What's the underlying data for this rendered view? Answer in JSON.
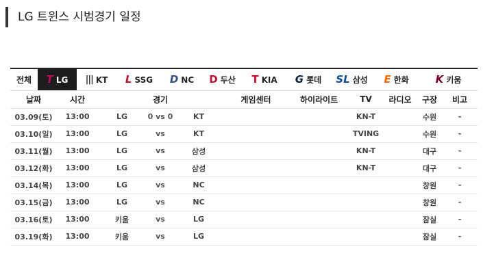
{
  "page": {
    "title": "LG 트윈스 시범경기 일정"
  },
  "tabs": [
    {
      "key": "all",
      "label": "전체",
      "logo": "",
      "active": false
    },
    {
      "key": "lg",
      "label": "LG",
      "logo": "T",
      "active": true
    },
    {
      "key": "kt",
      "label": "KT",
      "logo": "|||",
      "active": false
    },
    {
      "key": "ssg",
      "label": "SSG",
      "logo": "L",
      "active": false
    },
    {
      "key": "nc",
      "label": "NC",
      "logo": "D",
      "active": false
    },
    {
      "key": "doosan",
      "label": "두산",
      "logo": "D",
      "active": false
    },
    {
      "key": "kia",
      "label": "KIA",
      "logo": "T",
      "active": false
    },
    {
      "key": "lotte",
      "label": "롯데",
      "logo": "G",
      "active": false
    },
    {
      "key": "samsung",
      "label": "삼성",
      "logo": "SL",
      "active": false
    },
    {
      "key": "hanwha",
      "label": "한화",
      "logo": "E",
      "active": false
    },
    {
      "key": "kiwoom",
      "label": "키움",
      "logo": "K",
      "active": false
    }
  ],
  "table": {
    "headers": {
      "date": "날짜",
      "time": "시간",
      "game": "경기",
      "game_center": "게임센터",
      "highlight": "하이라이트",
      "tv": "TV",
      "radio": "라디오",
      "stadium": "구장",
      "note": "비고"
    },
    "rows": [
      {
        "date": "03.09(토)",
        "time": "13:00",
        "away": "LG",
        "score": "0 vs 0",
        "home": "KT",
        "tv": "KN-T",
        "radio": "",
        "stadium": "수원",
        "note": "-"
      },
      {
        "date": "03.10(일)",
        "time": "13:00",
        "away": "LG",
        "score": "vs",
        "home": "KT",
        "tv": "TVING",
        "radio": "",
        "stadium": "수원",
        "note": "-"
      },
      {
        "date": "03.11(월)",
        "time": "13:00",
        "away": "LG",
        "score": "vs",
        "home": "삼성",
        "tv": "KN-T",
        "radio": "",
        "stadium": "대구",
        "note": "-"
      },
      {
        "date": "03.12(화)",
        "time": "13:00",
        "away": "LG",
        "score": "vs",
        "home": "삼성",
        "tv": "KN-T",
        "radio": "",
        "stadium": "대구",
        "note": "-"
      },
      {
        "date": "03.14(목)",
        "time": "13:00",
        "away": "LG",
        "score": "vs",
        "home": "NC",
        "tv": "",
        "radio": "",
        "stadium": "창원",
        "note": "-"
      },
      {
        "date": "03.15(금)",
        "time": "13:00",
        "away": "LG",
        "score": "vs",
        "home": "NC",
        "tv": "",
        "radio": "",
        "stadium": "창원",
        "note": "-"
      },
      {
        "date": "03.16(토)",
        "time": "13:00",
        "away": "키움",
        "score": "vs",
        "home": "LG",
        "tv": "",
        "radio": "",
        "stadium": "잠실",
        "note": "-"
      },
      {
        "date": "03.19(화)",
        "time": "13:00",
        "away": "키움",
        "score": "vs",
        "home": "LG",
        "tv": "",
        "radio": "",
        "stadium": "잠실",
        "note": "-"
      }
    ]
  }
}
